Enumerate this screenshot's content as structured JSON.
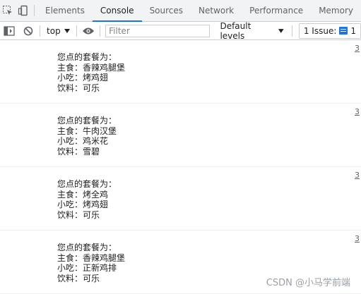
{
  "devtools": {
    "tabs": [
      {
        "label": "Elements"
      },
      {
        "label": "Console"
      },
      {
        "label": "Sources"
      },
      {
        "label": "Network"
      },
      {
        "label": "Performance"
      },
      {
        "label": "Memory"
      }
    ],
    "active_tab": "Console"
  },
  "toolbar": {
    "context": "top",
    "filter_placeholder": "Filter",
    "levels_label": "Default levels",
    "issues_label": "1 Issue:",
    "issues_count": "1"
  },
  "console": {
    "messages": [
      {
        "lines": [
          "您点的套餐为：",
          "主食：香辣鸡腿堡",
          "小吃：烤鸡翅",
          "饮料：可乐"
        ],
        "source": "3"
      },
      {
        "lines": [
          "您点的套餐为：",
          "主食：牛肉汉堡",
          "小吃：鸡米花",
          "饮料：雪碧"
        ],
        "source": "3"
      },
      {
        "lines": [
          "您点的套餐为：",
          "主食：烤全鸡",
          "小吃：烤鸡翅",
          "饮料：可乐"
        ],
        "source": "3"
      },
      {
        "lines": [
          "您点的套餐为：",
          "主食：香辣鸡腿堡",
          "小吃：正新鸡排",
          "饮料：可乐"
        ],
        "source": "3"
      }
    ]
  },
  "watermark": "CSDN @小马学前端",
  "colors": {
    "accent": "#1a73e8",
    "border": "#cbcdd1"
  }
}
